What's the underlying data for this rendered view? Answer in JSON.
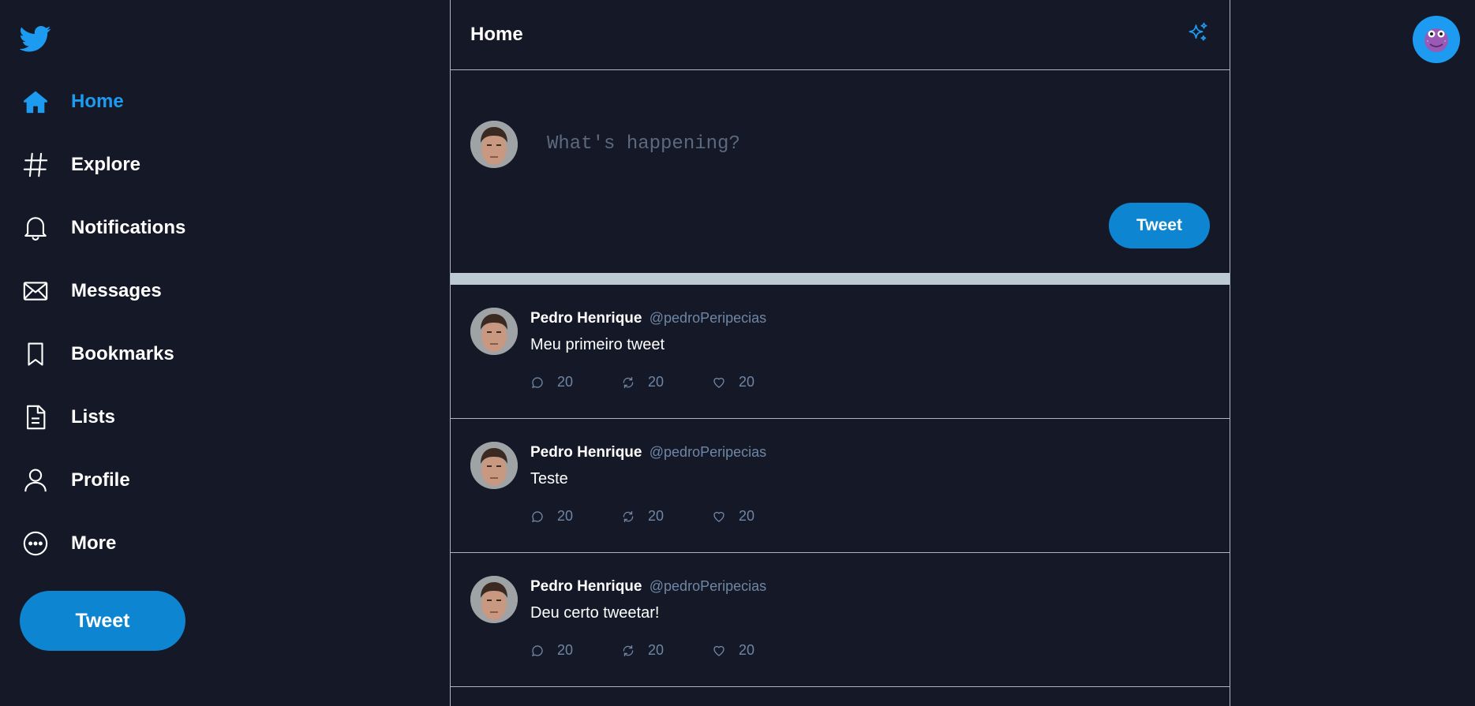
{
  "sidebar": {
    "logo": "twitter-bird-icon",
    "items": [
      {
        "label": "Home",
        "icon": "home-icon"
      },
      {
        "label": "Explore",
        "icon": "hash-icon"
      },
      {
        "label": "Notifications",
        "icon": "bell-icon"
      },
      {
        "label": "Messages",
        "icon": "envelope-icon"
      },
      {
        "label": "Bookmarks",
        "icon": "bookmark-icon"
      },
      {
        "label": "Lists",
        "icon": "list-icon"
      },
      {
        "label": "Profile",
        "icon": "user-icon"
      },
      {
        "label": "More",
        "icon": "more-icon"
      }
    ],
    "tweet_button": "Tweet"
  },
  "header": {
    "title": "Home",
    "sparkle_icon": "sparkle-icon"
  },
  "composer": {
    "placeholder": "What's happening?",
    "tweet_button": "Tweet"
  },
  "tweets": [
    {
      "name": "Pedro Henrique",
      "handle": "@pedroPeripecias",
      "text": "Meu primeiro tweet",
      "replies": "20",
      "retweets": "20",
      "likes": "20"
    },
    {
      "name": "Pedro Henrique",
      "handle": "@pedroPeripecias",
      "text": "Teste",
      "replies": "20",
      "retweets": "20",
      "likes": "20"
    },
    {
      "name": "Pedro Henrique",
      "handle": "@pedroPeripecias",
      "text": "Deu certo tweetar!",
      "replies": "20",
      "retweets": "20",
      "likes": "20"
    }
  ],
  "colors": {
    "background": "#141827",
    "accent": "#1d9bf0",
    "button": "#0d85d1",
    "muted": "#6f86a4"
  }
}
